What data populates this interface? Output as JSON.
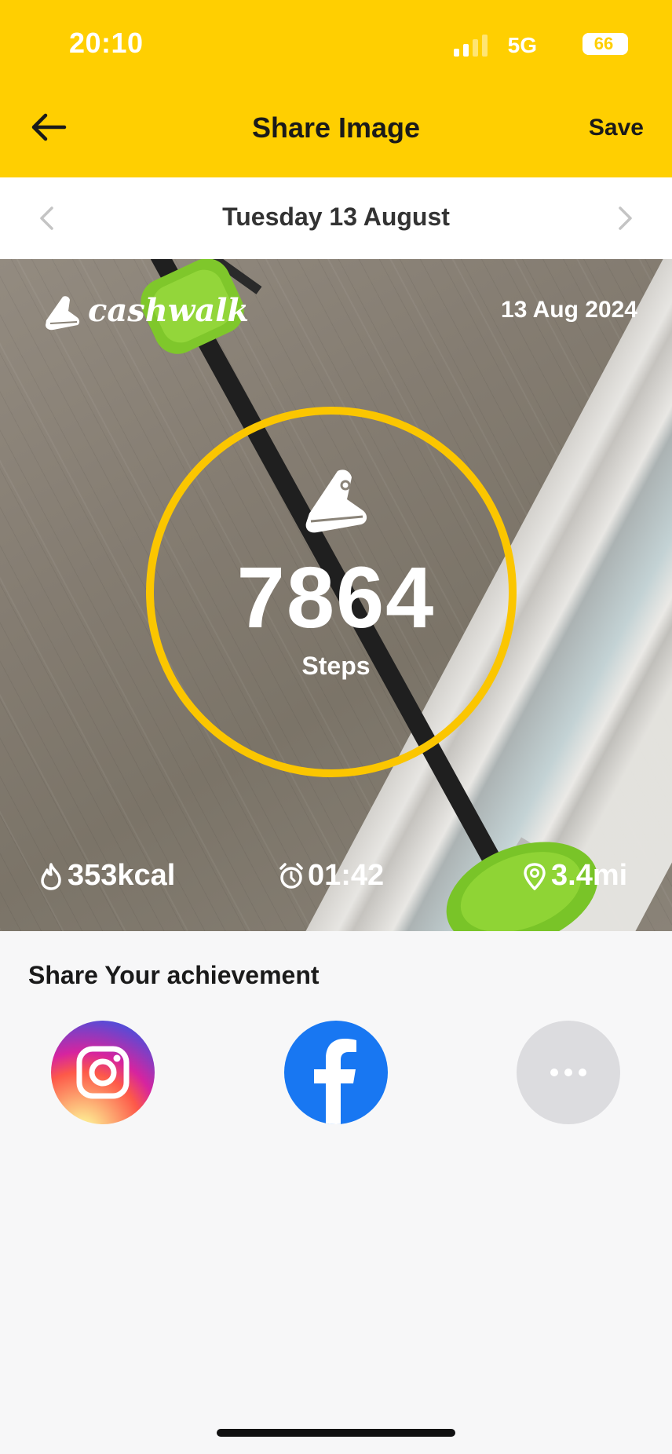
{
  "status_bar": {
    "time": "20:10",
    "network": "5G",
    "battery": "66"
  },
  "nav": {
    "title": "Share Image",
    "save_label": "Save"
  },
  "date_nav": {
    "label": "Tuesday 13 August"
  },
  "card": {
    "brand": "cashwalk",
    "date": "13 Aug 2024",
    "steps": "7864",
    "steps_label": "Steps",
    "stats": {
      "calories": "353kcal",
      "duration": "01:42",
      "distance": "3.4mi"
    }
  },
  "share": {
    "title": "Share Your achievement",
    "options": [
      "instagram",
      "facebook",
      "more"
    ]
  },
  "icons": [
    "back-arrow-icon",
    "chevron-left-icon",
    "chevron-right-icon",
    "shoe-icon",
    "flame-icon",
    "alarm-clock-icon",
    "location-pin-icon",
    "instagram-icon",
    "facebook-icon",
    "more-dots-icon"
  ],
  "colors": {
    "header": "#ffcf01",
    "ring": "#fbc600",
    "facebook": "#1877f2",
    "more_button": "#dcdcdf"
  }
}
